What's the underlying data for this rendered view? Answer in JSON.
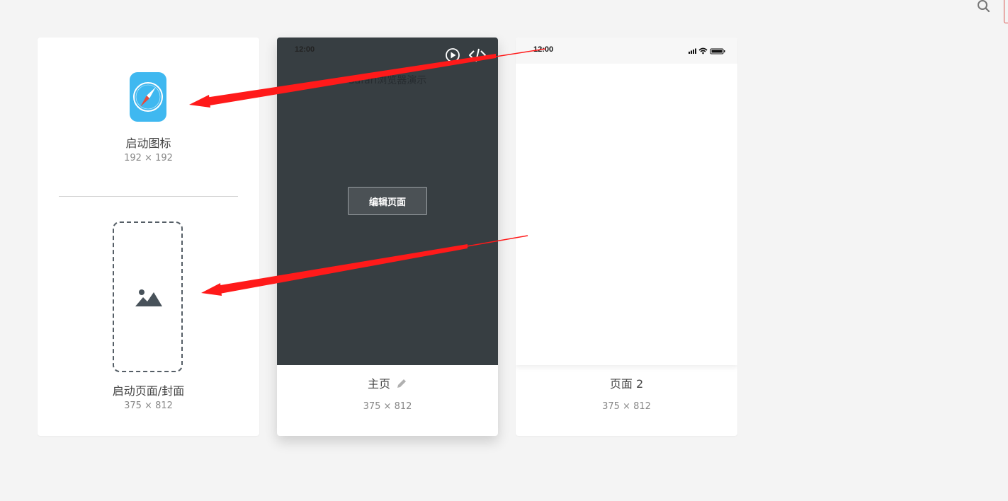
{
  "toolbar": {
    "search_icon": "search-icon"
  },
  "assets": {
    "launch_icon": {
      "label": "启动图标",
      "size": "192 × 192",
      "icon": "compass-icon",
      "color": "#3fb8f0"
    },
    "splash": {
      "label": "启动页面/封面",
      "size": "375 × 812",
      "icon": "image-icon"
    }
  },
  "pages": [
    {
      "name": "主页",
      "size": "375 × 812",
      "status_time": "12:00",
      "title": "Safari浏览器演示",
      "edit_label": "编辑页面",
      "theme": "#373e42",
      "icons": [
        "play-icon",
        "code-icon",
        "pencil-icon"
      ]
    },
    {
      "name": "页面 2",
      "size": "375 × 812",
      "status_time": "12:00",
      "icons": [
        "signal-icon",
        "wifi-icon",
        "battery-icon"
      ]
    }
  ],
  "annotation_color": "#ff1a1a"
}
